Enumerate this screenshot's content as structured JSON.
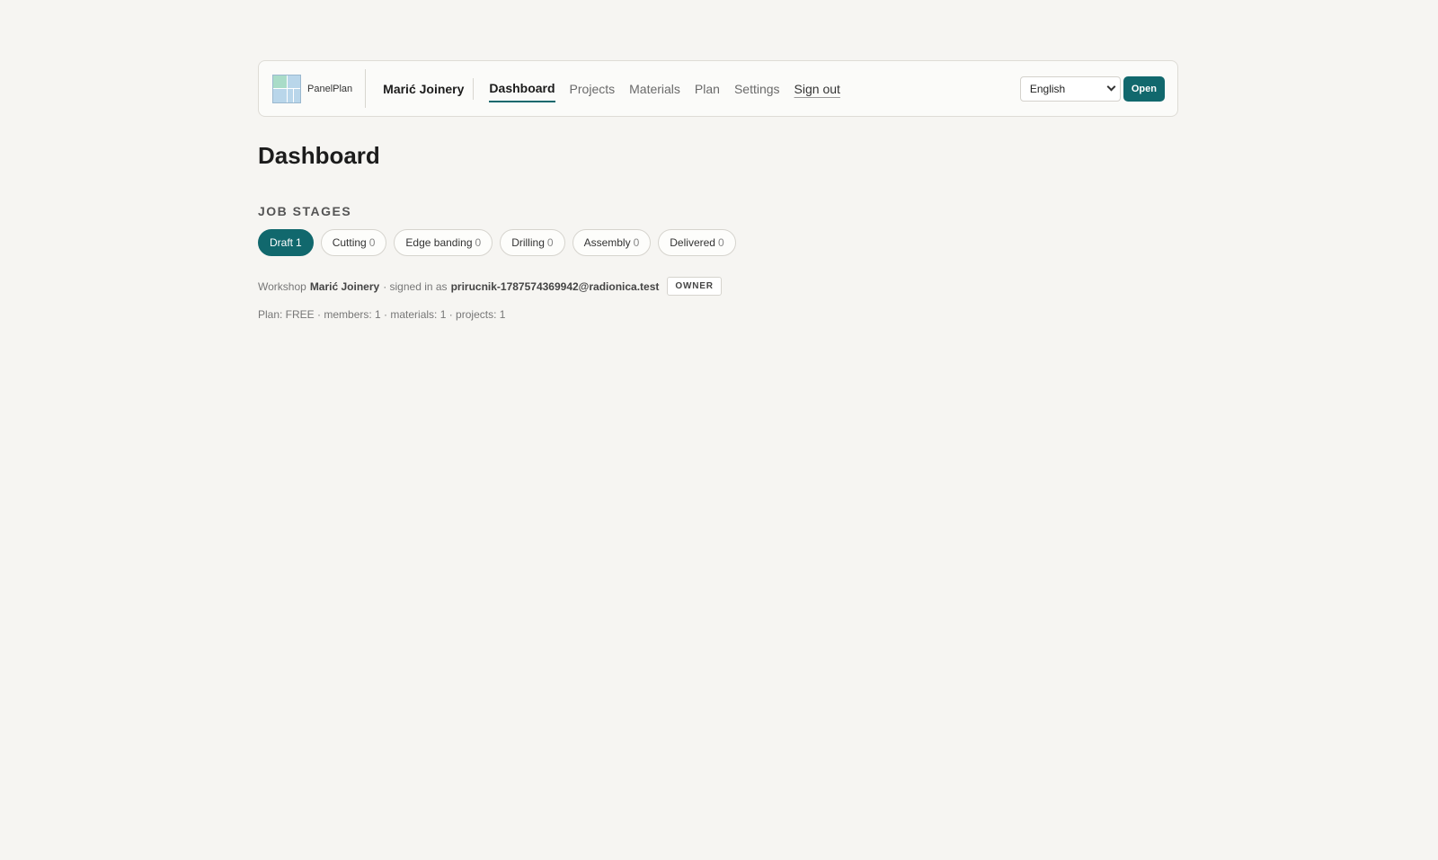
{
  "brand": {
    "name": "PanelPlan"
  },
  "header": {
    "workshop_name": "Marić Joinery",
    "nav": [
      {
        "label": "Dashboard",
        "active": true
      },
      {
        "label": "Projects",
        "active": false
      },
      {
        "label": "Materials",
        "active": false
      },
      {
        "label": "Plan",
        "active": false
      },
      {
        "label": "Settings",
        "active": false
      }
    ],
    "signout_label": "Sign out",
    "language": {
      "selected": "English"
    },
    "open_label": "Open"
  },
  "page": {
    "title": "Dashboard",
    "section_title": "JOB STAGES"
  },
  "stages": [
    {
      "label": "Draft",
      "count": "1",
      "active": true
    },
    {
      "label": "Cutting",
      "count": "0",
      "active": false
    },
    {
      "label": "Edge banding",
      "count": "0",
      "active": false
    },
    {
      "label": "Drilling",
      "count": "0",
      "active": false
    },
    {
      "label": "Assembly",
      "count": "0",
      "active": false
    },
    {
      "label": "Delivered",
      "count": "0",
      "active": false
    }
  ],
  "meta": {
    "workshop_prefix": "Workshop",
    "workshop_name": "Marić Joinery",
    "signed_in_text": "· signed in as",
    "email": "prirucnik-1787574369942@radionica.test",
    "role": "OWNER",
    "plan_line": "Plan: FREE · members: 1 · materials: 1 · projects: 1"
  },
  "colors": {
    "accent": "#11686d",
    "background": "#f6f5f2"
  }
}
